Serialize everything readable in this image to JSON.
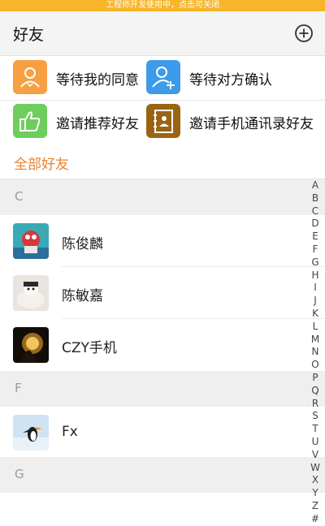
{
  "banner": {
    "text": "工程师开发使用中，点击可关闭"
  },
  "header": {
    "title": "好友",
    "add_icon": "plus-circle-icon"
  },
  "actions": [
    {
      "label": "等待我的同意",
      "icon": "person-heart-icon",
      "color": "#f6a043"
    },
    {
      "label": "等待对方确认",
      "icon": "person-add-icon",
      "color": "#3d9be9"
    },
    {
      "label": "邀请推荐好友",
      "icon": "thumbs-up-icon",
      "color": "#6dce5c"
    },
    {
      "label": "邀请手机通讯录好友",
      "icon": "contact-book-icon",
      "color": "#9a6413"
    }
  ],
  "all_friends_label": "全部好友",
  "sections": [
    {
      "letter": "C",
      "contacts": [
        "陈俊麟",
        "陈敏嘉",
        "CZY手机"
      ]
    },
    {
      "letter": "F",
      "contacts": [
        "Fx"
      ]
    },
    {
      "letter": "G",
      "contacts": []
    }
  ],
  "index_letters": [
    "A",
    "B",
    "C",
    "D",
    "E",
    "F",
    "G",
    "H",
    "I",
    "J",
    "K",
    "L",
    "M",
    "N",
    "O",
    "P",
    "Q",
    "R",
    "S",
    "T",
    "U",
    "V",
    "W",
    "X",
    "Y",
    "Z",
    "#"
  ]
}
